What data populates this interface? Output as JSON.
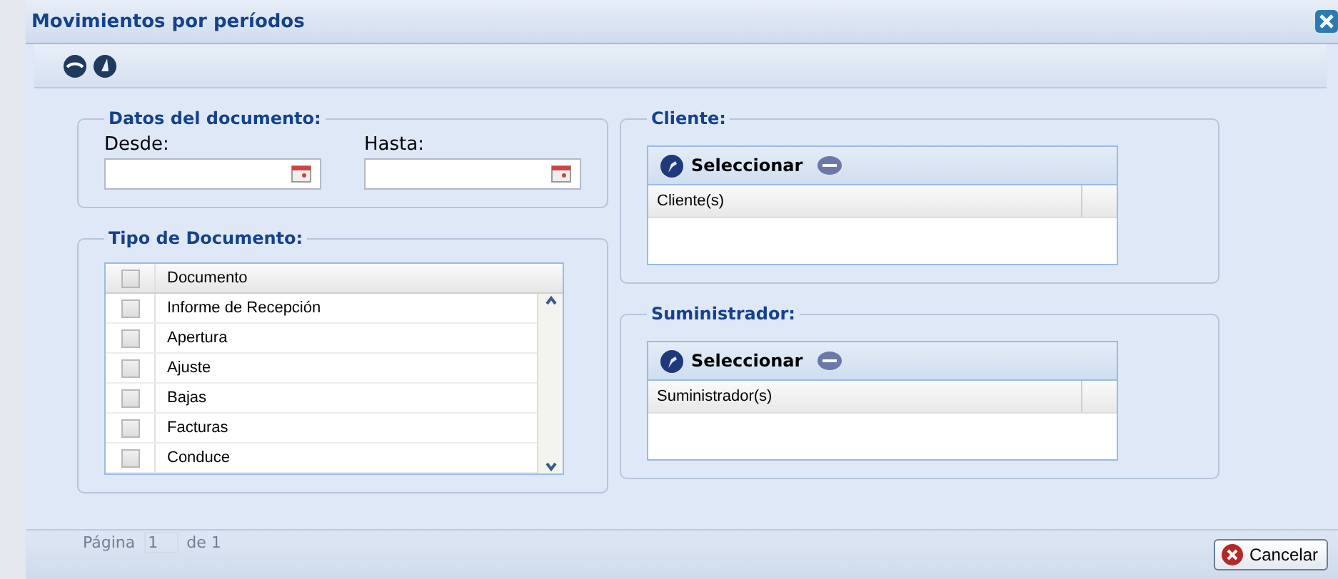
{
  "window": {
    "title": "Movimientos por períodos"
  },
  "datos": {
    "title": "Datos del documento:",
    "fields": [
      {
        "label": "Desde:"
      },
      {
        "label": "Hasta:"
      }
    ]
  },
  "tipo": {
    "title": "Tipo de Documento:",
    "header": {
      "label": "Documento",
      "checked": false
    },
    "rows": [
      {
        "label": "Informe de Recepción",
        "checked": false
      },
      {
        "label": "Apertura",
        "checked": false
      },
      {
        "label": "Ajuste",
        "checked": false
      },
      {
        "label": "Bajas",
        "checked": false
      },
      {
        "label": "Facturas",
        "checked": false
      },
      {
        "label": "Conduce",
        "checked": false
      }
    ]
  },
  "panels": [
    {
      "title": "Cliente:",
      "button": "Seleccionar",
      "column": "Cliente(s)"
    },
    {
      "title": "Suministrador:",
      "button": "Seleccionar",
      "column": "Suministrador(s)"
    }
  ],
  "background_pager": {
    "label": "Página",
    "page": "1",
    "of": "de 1"
  },
  "buttons": [
    {
      "label": "Cancelar"
    }
  ]
}
